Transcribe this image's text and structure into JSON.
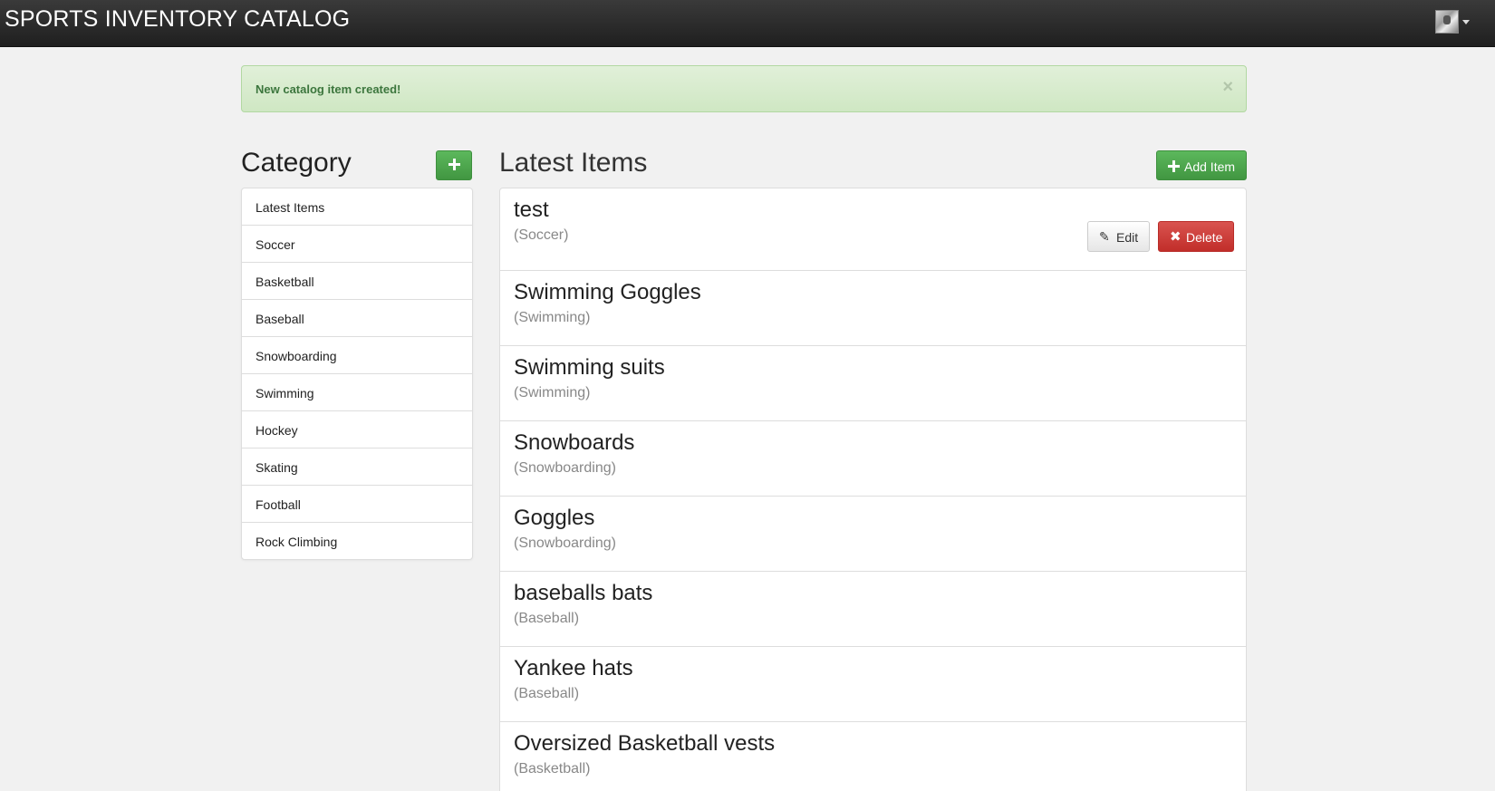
{
  "navbar": {
    "brand": "SPORTS INVENTORY CATALOG"
  },
  "alert": {
    "message": "New catalog item created!",
    "close_glyph": "×"
  },
  "sidebar": {
    "heading": "Category",
    "items": [
      {
        "label": "Latest Items"
      },
      {
        "label": "Soccer"
      },
      {
        "label": "Basketball"
      },
      {
        "label": "Baseball"
      },
      {
        "label": "Snowboarding"
      },
      {
        "label": "Swimming"
      },
      {
        "label": "Hockey"
      },
      {
        "label": "Skating"
      },
      {
        "label": "Football"
      },
      {
        "label": "Rock Climbing"
      }
    ]
  },
  "main": {
    "heading": "Latest Items",
    "add_item_label": "Add Item",
    "edit_label": "Edit",
    "delete_label": "Delete",
    "items": [
      {
        "name": "test",
        "category": "(Soccer)"
      },
      {
        "name": "Swimming Goggles",
        "category": "(Swimming)"
      },
      {
        "name": "Swimming suits",
        "category": "(Swimming)"
      },
      {
        "name": "Snowboards",
        "category": "(Snowboarding)"
      },
      {
        "name": "Goggles",
        "category": "(Snowboarding)"
      },
      {
        "name": "baseballs bats",
        "category": "(Baseball)"
      },
      {
        "name": "Yankee hats",
        "category": "(Baseball)"
      },
      {
        "name": "Oversized Basketball vests",
        "category": "(Basketball)"
      }
    ]
  },
  "colors": {
    "success": "#5cb85c",
    "danger": "#d9534f",
    "alert_bg": "#dff0d8",
    "navbar": "#222222"
  }
}
